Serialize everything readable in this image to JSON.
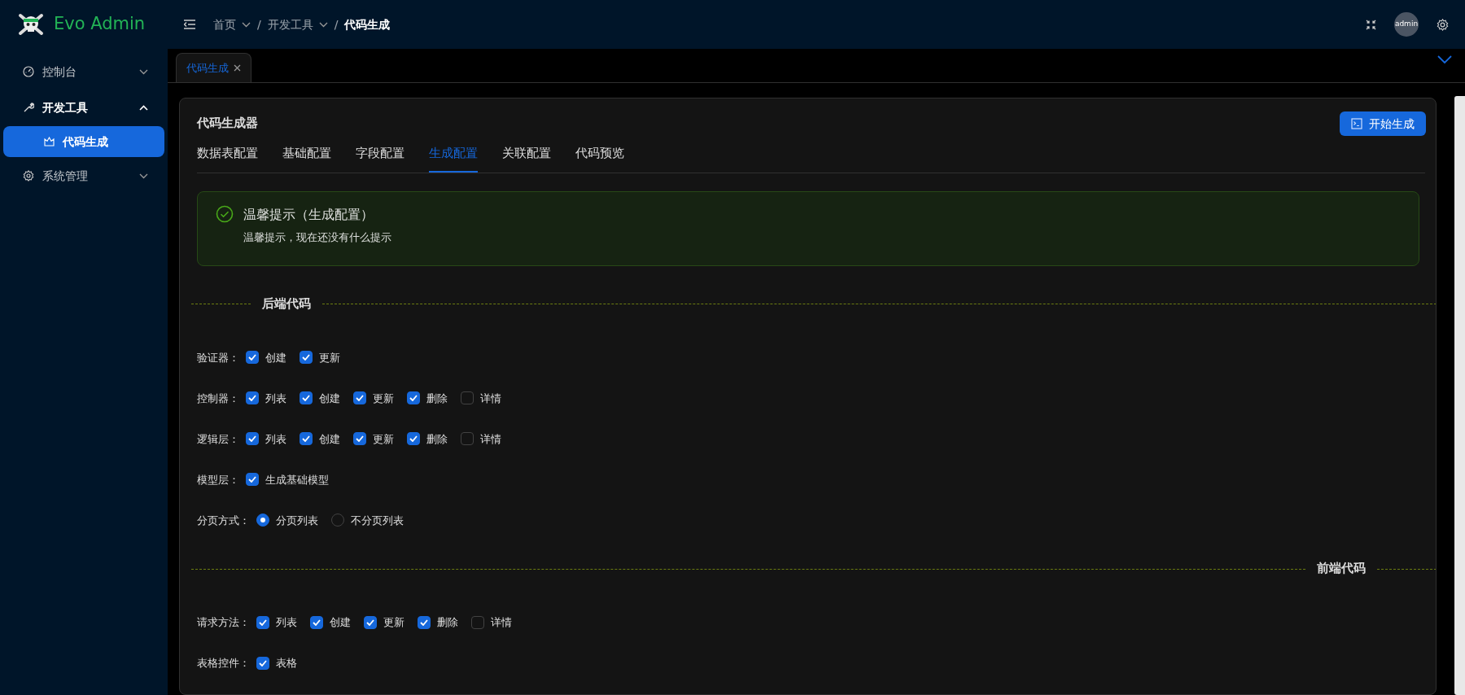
{
  "brand": {
    "name": "Evo Admin"
  },
  "breadcrumb": [
    {
      "label": "首页",
      "dropdown": true,
      "current": false
    },
    {
      "separator": "/",
      "label": "开发工具",
      "dropdown": true,
      "current": false
    },
    {
      "separator": "/",
      "label": "代码生成",
      "dropdown": false,
      "current": true
    }
  ],
  "header": {
    "avatar": "admin"
  },
  "sidebar": {
    "items": [
      {
        "label": "控制台",
        "expanded": false
      },
      {
        "label": "开发工具",
        "expanded": true,
        "children": [
          {
            "label": "代码生成",
            "selected": true
          }
        ]
      },
      {
        "label": "系统管理",
        "expanded": false
      }
    ]
  },
  "page_tabs": [
    {
      "label": "代码生成",
      "selected": true
    }
  ],
  "card": {
    "title": "代码生成器",
    "action": "开始生成",
    "tabs": [
      {
        "label": "数据表配置",
        "selected": false
      },
      {
        "label": "基础配置",
        "selected": false
      },
      {
        "label": "字段配置",
        "selected": false
      },
      {
        "label": "生成配置",
        "selected": true
      },
      {
        "label": "关联配置",
        "selected": false
      },
      {
        "label": "代码预览",
        "selected": false
      }
    ],
    "alert": {
      "title": "温馨提示（生成配置）",
      "message": "温馨提示，现在还没有什么提示"
    },
    "sections": [
      {
        "title": "后端代码",
        "kind": "left",
        "rows": [
          {
            "label": "验证器：",
            "kind": "checkbox",
            "options": [
              {
                "label": "创建",
                "checked": true
              },
              {
                "label": "更新",
                "checked": true
              }
            ]
          },
          {
            "label": "控制器：",
            "kind": "checkbox",
            "options": [
              {
                "label": "列表",
                "checked": true
              },
              {
                "label": "创建",
                "checked": true
              },
              {
                "label": "更新",
                "checked": true
              },
              {
                "label": "删除",
                "checked": true
              },
              {
                "label": "详情",
                "checked": false
              }
            ]
          },
          {
            "label": "逻辑层：",
            "kind": "checkbox",
            "options": [
              {
                "label": "列表",
                "checked": true
              },
              {
                "label": "创建",
                "checked": true
              },
              {
                "label": "更新",
                "checked": true
              },
              {
                "label": "删除",
                "checked": true
              },
              {
                "label": "详情",
                "checked": false
              }
            ]
          },
          {
            "label": "模型层：",
            "kind": "checkbox",
            "options": [
              {
                "label": "生成基础模型",
                "checked": true
              }
            ]
          },
          {
            "label": "分页方式：",
            "kind": "radio",
            "options": [
              {
                "label": "分页列表",
                "selected": true
              },
              {
                "label": "不分页列表",
                "selected": false
              }
            ]
          }
        ]
      },
      {
        "title": "前端代码",
        "kind": "right",
        "rows": [
          {
            "label": "请求方法：",
            "kind": "checkbox",
            "options": [
              {
                "label": "列表",
                "checked": true
              },
              {
                "label": "创建",
                "checked": true
              },
              {
                "label": "更新",
                "checked": true
              },
              {
                "label": "删除",
                "checked": true
              },
              {
                "label": "详情",
                "checked": false
              }
            ]
          },
          {
            "label": "表格控件：",
            "kind": "checkbox",
            "options": [
              {
                "label": "表格",
                "checked": true
              }
            ]
          }
        ]
      }
    ]
  }
}
